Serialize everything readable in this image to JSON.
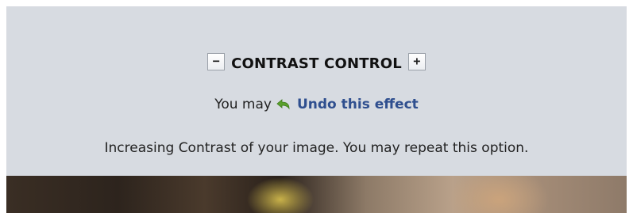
{
  "contrast_control": {
    "title": "CONTRAST CONTROL",
    "decrease_label": "−",
    "increase_label": "+",
    "undo_prefix": "You may",
    "undo_link": "Undo this effect",
    "undo_icon": "undo-arrow-icon",
    "info_text": "Increasing Contrast of your image. You may repeat this option."
  },
  "colors": {
    "panel_background": "#d7dbe1",
    "link": "#2f4f8f",
    "undo_icon": "#5aa02c"
  }
}
